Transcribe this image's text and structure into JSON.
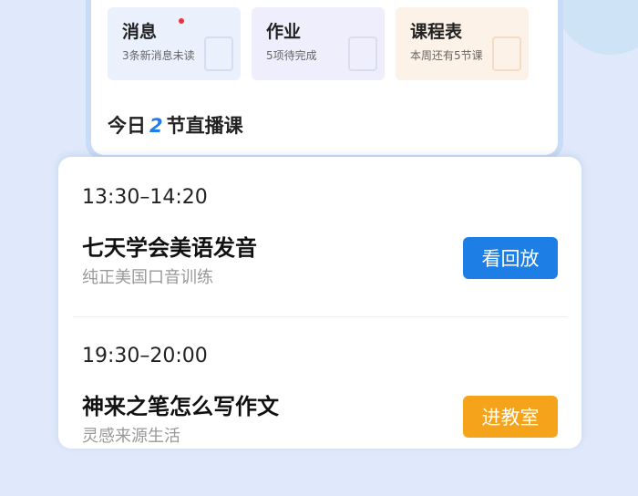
{
  "shortcuts": [
    {
      "title": "消息",
      "subtitle": "3条新消息未读",
      "has_dot": true
    },
    {
      "title": "作业",
      "subtitle": "5项待完成",
      "has_dot": false
    },
    {
      "title": "课程表",
      "subtitle": "本周还有5节课",
      "has_dot": false
    }
  ],
  "today": {
    "prefix": "今日",
    "count": "2",
    "suffix": "节直播课"
  },
  "lessons": [
    {
      "time": "13:30–14:20",
      "title": "七天学会美语发音",
      "subtitle": "纯正美国口音训练",
      "button": "看回放"
    },
    {
      "time": "19:30–20:00",
      "title": "神来之笔怎么写作文",
      "subtitle": "灵感来源生活",
      "button": "进教室"
    }
  ],
  "colors": {
    "accent_blue": "#1d7fe6",
    "accent_orange": "#f5a31a",
    "dot_red": "#f0303a"
  }
}
